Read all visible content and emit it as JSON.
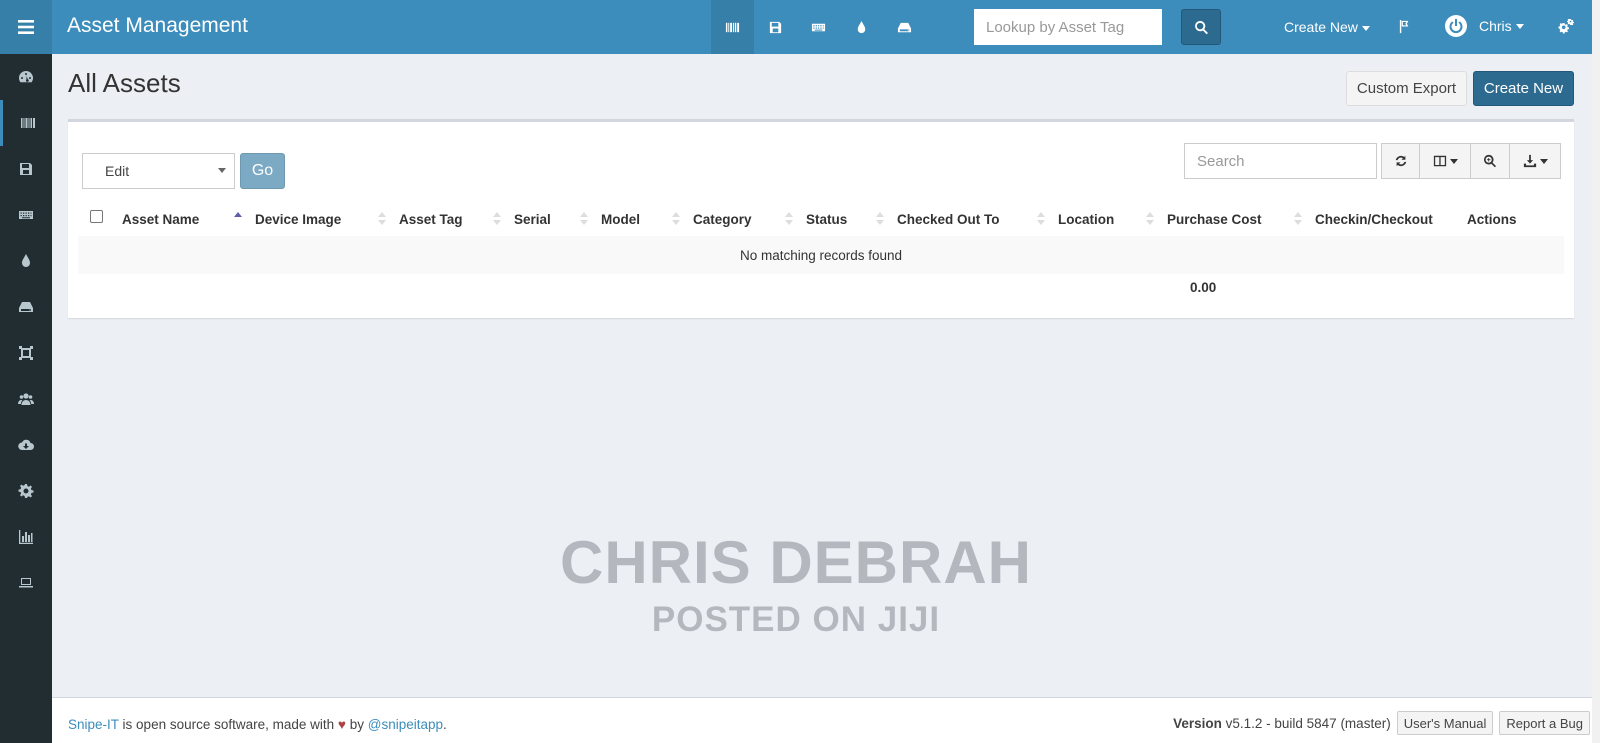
{
  "header": {
    "brand": "Asset Management",
    "lookup_placeholder": "Lookup by Asset Tag",
    "create_new": "Create New",
    "user_name": "Chris"
  },
  "page": {
    "title": "All Assets",
    "custom_export": "Custom Export",
    "create_new": "Create New"
  },
  "toolbar": {
    "bulk_action": "Edit",
    "go": "Go",
    "search_placeholder": "Search"
  },
  "table": {
    "columns": [
      "Asset Name",
      "Device Image",
      "Asset Tag",
      "Serial",
      "Model",
      "Category",
      "Status",
      "Checked Out To",
      "Location",
      "Purchase Cost",
      "Checkin/Checkout",
      "Actions"
    ],
    "empty_message": "No matching records found",
    "purchase_cost_total": "0.00"
  },
  "watermark": {
    "line1": "CHRIS DEBRAH",
    "line2": "POSTED ON JIJI"
  },
  "footer": {
    "product": "Snipe-IT",
    "text_before": "is open source software, made with",
    "heart": "♥",
    "by": "by",
    "handle": "@snipeitapp",
    "period": ".",
    "version_label": "Version",
    "version_value": "v5.1.2 - build 5847 (master)",
    "users_manual": "User's Manual",
    "report_bug": "Report a Bug"
  },
  "colors": {
    "header": "#3c8dbc",
    "sidebar": "#222d32",
    "primary_button": "#2d6a8f"
  },
  "icons": {
    "sidebar": [
      "hamburger-icon",
      "dashboard-icon",
      "barcode-icon",
      "floppy-icon",
      "keyboard-icon",
      "droplet-icon",
      "hdd-icon",
      "kit-icon",
      "users-icon",
      "cloud-download-icon",
      "gear-icon",
      "chart-icon",
      "laptop-icon"
    ],
    "quick": [
      "barcode-icon",
      "floppy-icon",
      "keyboard-icon",
      "droplet-icon",
      "hdd-icon"
    ]
  }
}
